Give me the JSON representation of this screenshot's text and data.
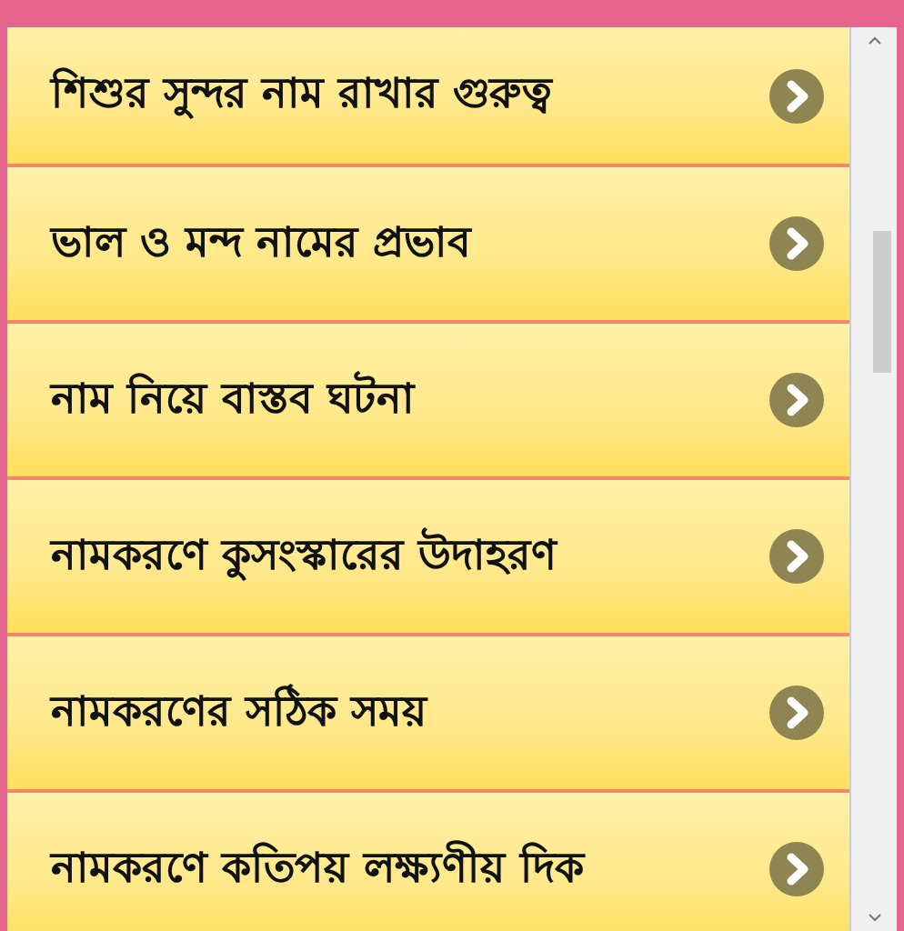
{
  "items": [
    {
      "label": "শিশুর সুন্দর নাম রাখার গুরুত্ব"
    },
    {
      "label": "ভাল ও মন্দ নামের প্রভাব"
    },
    {
      "label": "নাম নিয়ে বাস্তব ঘটনা"
    },
    {
      "label": "নামকরণে কুসংস্কারের উদাহরণ"
    },
    {
      "label": "নামকরণের সঠিক সময়"
    },
    {
      "label": "নামকরণে কতিপয় লক্ষ্যণীয় দিক"
    }
  ]
}
